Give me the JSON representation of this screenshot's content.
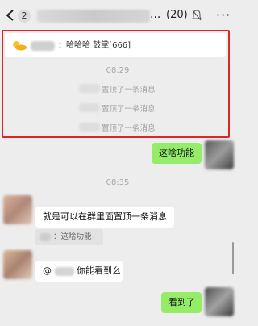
{
  "header": {
    "unread_count": "2",
    "title_trailing": "...",
    "member_count": "(20)",
    "more_label": "···"
  },
  "pinned": {
    "text": "：哈哈哈 鼓掌[666]"
  },
  "times": {
    "first": "08:29",
    "second": "08:35"
  },
  "system_messages": [
    {
      "text": "置顶了一条消息"
    },
    {
      "text": "置顶了一条消息"
    },
    {
      "text": "置顶了一条消息"
    }
  ],
  "messages": {
    "m1": "这啥功能",
    "m2": "就是可以在群里面置顶一条消息",
    "m2_quote": "：这啥功能",
    "m3_prefix": "@",
    "m3_suffix": "你能看到么",
    "m4": "看到了"
  },
  "colors": {
    "background": "#ededed",
    "highlight": "#e0242a",
    "green_bubble": "#95ec69"
  }
}
